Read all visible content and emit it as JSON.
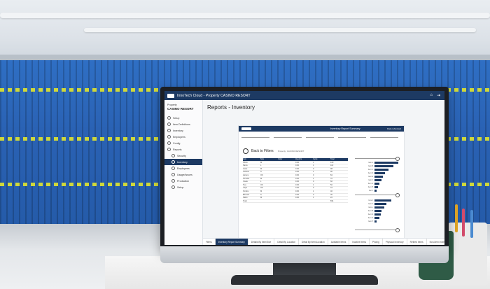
{
  "app": {
    "title": "InnoTech Cloud - Property CASINO RESORT",
    "property_label": "Property",
    "property_name": "CASINO RESORT",
    "icons": [
      "home-icon",
      "logout-icon"
    ]
  },
  "sidebar": {
    "items": [
      {
        "label": "Setup"
      },
      {
        "label": "Item Definitions"
      },
      {
        "label": "Inventory"
      },
      {
        "label": "Employees"
      },
      {
        "label": "Config"
      },
      {
        "label": "Reports"
      },
      {
        "label": "Security",
        "sub": true
      },
      {
        "label": "Inventory",
        "sub": true,
        "active": true
      },
      {
        "label": "Employees",
        "sub": true
      },
      {
        "label": "Usage/Issues",
        "sub": true
      },
      {
        "label": "Production",
        "sub": true
      },
      {
        "label": "Setup",
        "sub": true
      }
    ]
  },
  "page": {
    "title": "Reports - Inventory"
  },
  "report": {
    "logo_text": "InnoTech Cloud",
    "header_title": "Inventory Report Summary",
    "header_right": "Data refreshed",
    "back_label": "Back to Filters",
    "back_sub": "Property: CASINO RESORT",
    "table_headers": [
      "Item",
      "Size",
      "Color",
      "Avg Hrs",
      "Cycle",
      "Total"
    ],
    "table_rows": [
      [
        "Shirts",
        "M",
        "",
        "0.00",
        "1",
        "120"
      ],
      [
        "Pants",
        "L",
        "",
        "0.00",
        "1",
        "110"
      ],
      [
        "Vests",
        "M",
        "",
        "0.00",
        "0",
        "98"
      ],
      [
        "Jackets",
        "S",
        "",
        "0.00",
        "1",
        "90"
      ],
      [
        "Aprons",
        "OS",
        "",
        "0.00",
        "0",
        "84"
      ],
      [
        "Smocks",
        "M",
        "",
        "0.00",
        "1",
        "70"
      ],
      [
        "Coats",
        "L",
        "",
        "0.00",
        "0",
        "66"
      ],
      [
        "Ties",
        "OS",
        "",
        "0.00",
        "1",
        "50"
      ],
      [
        "Caps",
        "OS",
        "",
        "0.00",
        "0",
        "44"
      ],
      [
        "Scrubs",
        "M",
        "",
        "0.00",
        "1",
        "40"
      ],
      [
        "Blouses",
        "S",
        "",
        "0.00",
        "0",
        "30"
      ],
      [
        "Skirts",
        "M",
        "",
        "0.00",
        "1",
        "22"
      ],
      [
        "Total",
        "",
        "",
        "",
        "",
        "834"
      ]
    ],
    "bars": [
      {
        "label": "Item A",
        "value": 1.0
      },
      {
        "label": "Item B",
        "value": 0.8
      },
      {
        "label": "Item C",
        "value": 0.6
      },
      {
        "label": "Item D",
        "value": 0.45
      },
      {
        "label": "Item E",
        "value": 0.35
      },
      {
        "label": "Item F",
        "value": 0.3
      },
      {
        "label": "Item G",
        "value": 0.2
      },
      {
        "label": "Item H",
        "value": 0.15
      },
      {
        "label": "Item I",
        "value": 0.1
      }
    ],
    "bars2": [
      {
        "label": "Item J",
        "value": 0.7
      },
      {
        "label": "Item K",
        "value": 0.5
      },
      {
        "label": "Item L",
        "value": 0.4
      },
      {
        "label": "Item M",
        "value": 0.3
      },
      {
        "label": "Item N",
        "value": 0.25
      },
      {
        "label": "Item O",
        "value": 0.2
      },
      {
        "label": "Item P",
        "value": 0.1
      }
    ]
  },
  "tabs": [
    {
      "label": "Filters"
    },
    {
      "label": "Inventory Report Summary",
      "active": true
    },
    {
      "label": "Details By Item/Size"
    },
    {
      "label": "Detail By Location"
    },
    {
      "label": "Detail By Item/Location"
    },
    {
      "label": "Available Items"
    },
    {
      "label": "Inactive Items"
    },
    {
      "label": "Pricing"
    },
    {
      "label": "Physical Inventory"
    },
    {
      "label": "Retired Items"
    },
    {
      "label": "Non-Item Inventory"
    }
  ],
  "colors": {
    "brand": "#1d3a63",
    "garment_blue": "#2a62b4",
    "stripe": "#cfd83a"
  }
}
